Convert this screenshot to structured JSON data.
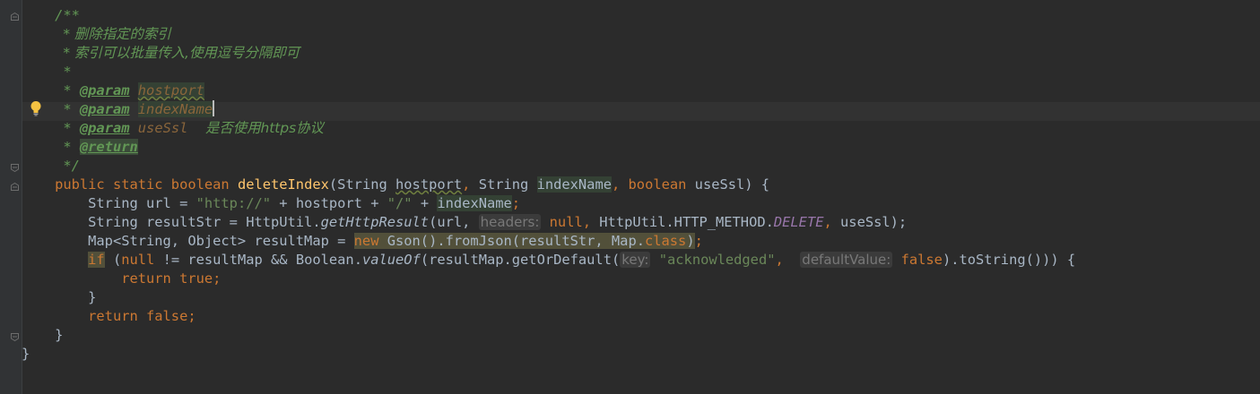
{
  "editor": {
    "lines": [
      {
        "indent": "    ",
        "parts": [
          {
            "t": "/**",
            "c": "cm"
          }
        ]
      },
      {
        "indent": "     ",
        "parts": [
          {
            "t": "* 删除指定的索引",
            "c": "cm"
          }
        ]
      },
      {
        "indent": "     ",
        "parts": [
          {
            "t": "* 索引可以批量传入,使用逗号分隔即可",
            "c": "cm"
          }
        ]
      },
      {
        "indent": "     ",
        "parts": [
          {
            "t": "*",
            "c": "cm"
          }
        ]
      },
      {
        "indent": "     ",
        "parts": [
          {
            "t": "* ",
            "c": "cm"
          },
          {
            "t": "@param",
            "c": "tag"
          },
          {
            "t": " ",
            "c": "cm"
          },
          {
            "t": "hostport",
            "c": "pname wavy pnamebg"
          }
        ]
      },
      {
        "indent": "     ",
        "parts": [
          {
            "t": "* ",
            "c": "cm"
          },
          {
            "t": "@param",
            "c": "tag"
          },
          {
            "t": " ",
            "c": "cm"
          },
          {
            "t": "indexName",
            "c": "pname pnamebg"
          },
          {
            "t": "",
            "c": "cursor"
          }
        ]
      },
      {
        "indent": "     ",
        "parts": [
          {
            "t": "* ",
            "c": "cm"
          },
          {
            "t": "@param",
            "c": "tag"
          },
          {
            "t": " ",
            "c": "cm"
          },
          {
            "t": "useSsl",
            "c": "pname"
          },
          {
            "t": "    是否使用https协议",
            "c": "cm"
          }
        ]
      },
      {
        "indent": "     ",
        "parts": [
          {
            "t": "* ",
            "c": "cm"
          },
          {
            "t": "@return",
            "c": "tag tagbg"
          }
        ]
      },
      {
        "indent": "     ",
        "parts": [
          {
            "t": "*/",
            "c": "cm"
          }
        ]
      },
      {
        "indent": "    ",
        "parts": [
          {
            "t": "public static boolean ",
            "c": "kw"
          },
          {
            "t": "deleteIndex",
            "c": "fn"
          },
          {
            "t": "(String ",
            "c": ""
          },
          {
            "t": "hostport",
            "c": "wavy"
          },
          {
            "t": ", ",
            "c": "kw"
          },
          {
            "t": "String ",
            "c": ""
          },
          {
            "t": "indexName",
            "c": "hl"
          },
          {
            "t": ", ",
            "c": "kw"
          },
          {
            "t": "boolean ",
            "c": "kw"
          },
          {
            "t": "useSsl) {",
            "c": ""
          }
        ]
      },
      {
        "indent": "        ",
        "parts": [
          {
            "t": "String url = ",
            "c": ""
          },
          {
            "t": "\"http://\"",
            "c": "str"
          },
          {
            "t": " + hostport + ",
            "c": ""
          },
          {
            "t": "\"/\"",
            "c": "str"
          },
          {
            "t": " + ",
            "c": ""
          },
          {
            "t": "indexName",
            "c": "hl"
          },
          {
            "t": ";",
            "c": "kw"
          }
        ]
      },
      {
        "indent": "        ",
        "parts": [
          {
            "t": "String resultStr = HttpUtil.",
            "c": ""
          },
          {
            "t": "getHttpResult",
            "c": "ital"
          },
          {
            "t": "(url, ",
            "c": ""
          },
          {
            "t": "headers:",
            "c": "hint"
          },
          {
            "t": " null",
            "c": "kw"
          },
          {
            "t": ", ",
            "c": "kw"
          },
          {
            "t": "HttpUtil.HTTP_METHOD.",
            "c": ""
          },
          {
            "t": "DELETE",
            "c": "const"
          },
          {
            "t": ", ",
            "c": "kw"
          },
          {
            "t": "useSsl);",
            "c": ""
          }
        ]
      },
      {
        "indent": "        ",
        "parts": [
          {
            "t": "Map<String, Object> resultMap = ",
            "c": ""
          },
          {
            "t": "new Gson().fromJson(resultStr, Map.",
            "c": "warnbg kw-new"
          },
          {
            "t": "class",
            "c": "warnbg kw"
          },
          {
            "t": ")",
            "c": "warnbg"
          },
          {
            "t": ";",
            "c": "kw"
          }
        ]
      },
      {
        "indent": "        ",
        "parts": [
          {
            "t": "if",
            "c": "kw warnbg"
          },
          {
            "t": " (",
            "c": ""
          },
          {
            "t": "null",
            "c": "kw"
          },
          {
            "t": " != resultMap && Boolean.",
            "c": ""
          },
          {
            "t": "valueOf",
            "c": "ital"
          },
          {
            "t": "(resultMap.getOrDefault(",
            "c": ""
          },
          {
            "t": "key:",
            "c": "hint"
          },
          {
            "t": " ",
            "c": ""
          },
          {
            "t": "\"acknowledged\"",
            "c": "str"
          },
          {
            "t": ",  ",
            "c": "kw"
          },
          {
            "t": "defaultValue:",
            "c": "hint"
          },
          {
            "t": " false",
            "c": "kw"
          },
          {
            "t": ").toString())) {",
            "c": ""
          }
        ]
      },
      {
        "indent": "            ",
        "parts": [
          {
            "t": "return true;",
            "c": "kw"
          }
        ]
      },
      {
        "indent": "        ",
        "parts": [
          {
            "t": "}",
            "c": ""
          }
        ]
      },
      {
        "indent": "        ",
        "parts": [
          {
            "t": "return false;",
            "c": "kw"
          }
        ]
      },
      {
        "indent": "    ",
        "parts": [
          {
            "t": "}",
            "c": ""
          }
        ]
      },
      {
        "indent": "",
        "parts": [
          {
            "t": "}",
            "c": ""
          }
        ]
      }
    ]
  },
  "gutter": {
    "bulb_icon": "lightbulb-icon"
  }
}
